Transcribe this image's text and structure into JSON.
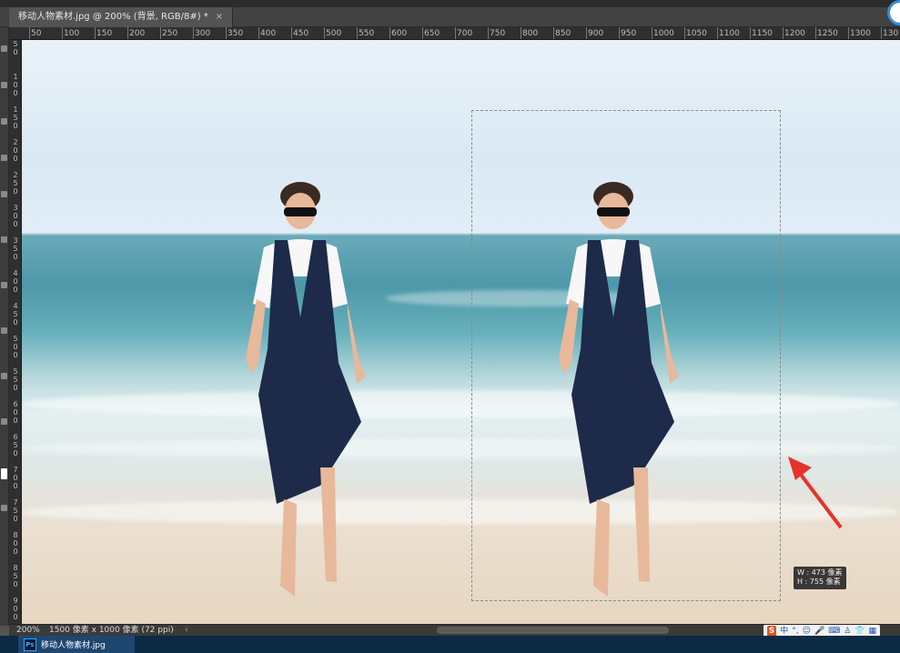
{
  "tab": {
    "title": "移动人物素材.jpg @ 200% (背景, RGB/8#) *",
    "close": "×"
  },
  "ruler_h": [
    "50",
    "100",
    "150",
    "200",
    "250",
    "300",
    "350",
    "400",
    "450",
    "500",
    "550",
    "600",
    "650",
    "700",
    "750",
    "800",
    "850",
    "900",
    "950",
    "1000",
    "1050",
    "1100",
    "1150",
    "1200",
    "1250",
    "1300",
    "130"
  ],
  "ruler_v": [
    "5\n0",
    "1\n0\n0",
    "1\n5\n0",
    "2\n0\n0",
    "2\n5\n0",
    "3\n0\n0",
    "3\n5\n0",
    "4\n0\n0",
    "4\n5\n0",
    "5\n0\n0",
    "5\n5\n0",
    "6\n0\n0",
    "6\n5\n0",
    "7\n0\n0",
    "7\n5\n0",
    "8\n0\n0",
    "8\n5\n0",
    "9\n0\n0"
  ],
  "size_tip": {
    "w": "W : 473 像素",
    "h": "H : 755 像素"
  },
  "status": {
    "zoom": "200%",
    "info": "1500 像素 x 1000 像素 (72 ppi)",
    "nav_right": "›",
    "nav_left": "‹"
  },
  "ime": {
    "logo": "S",
    "mode": "中",
    "punct": "°,",
    "emoji": "☺",
    "mic": "🎤",
    "keyboard": "⌨",
    "person": "♙",
    "shirt": "👕",
    "grid": "▦"
  },
  "taskbar": {
    "ps_badge": "Ps",
    "ps_label": "移动人物素材.jpg"
  },
  "colors": {
    "accent_arrow": "#e8322b",
    "selection": "#8a8a8a"
  }
}
